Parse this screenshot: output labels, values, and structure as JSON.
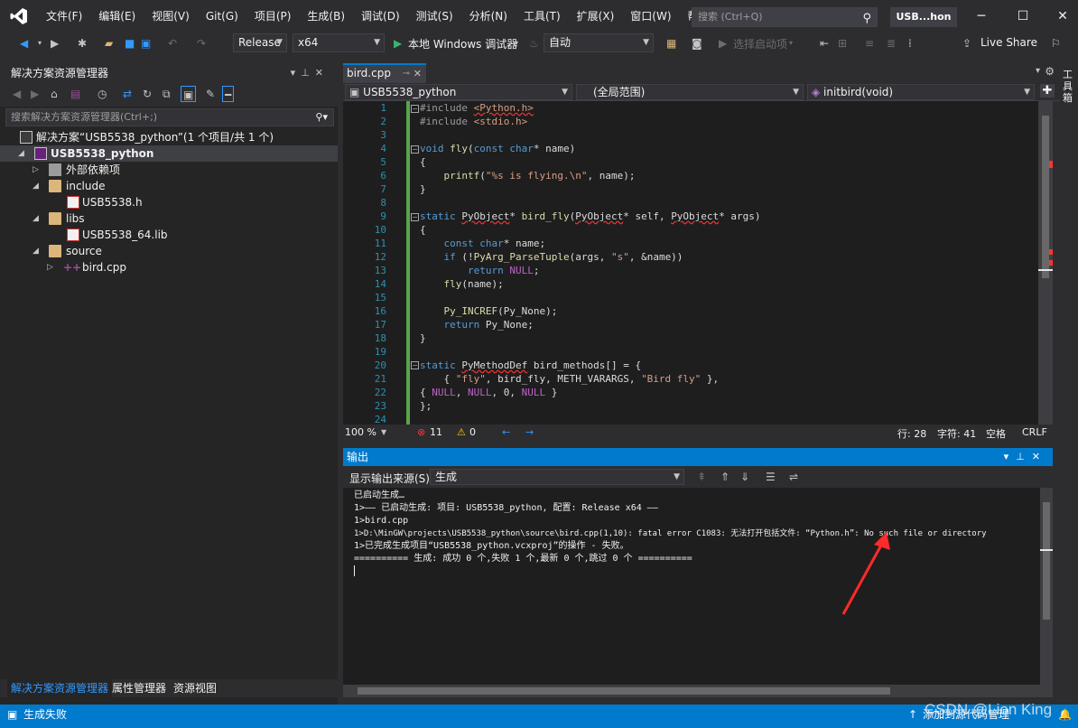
{
  "menu": {
    "items": [
      "文件(F)",
      "编辑(E)",
      "视图(V)",
      "Git(G)",
      "项目(P)",
      "生成(B)",
      "调试(D)",
      "测试(S)",
      "分析(N)",
      "工具(T)",
      "扩展(X)",
      "窗口(W)",
      "帮助(H)"
    ],
    "search_placeholder": "搜索 (Ctrl+Q)",
    "solution_name": "USB...hon"
  },
  "toolbar": {
    "config": "Release",
    "platform": "x64",
    "debugger": "本地 Windows 调试器",
    "auto": "自动",
    "startup": "选择启动项",
    "live_share": "Live Share"
  },
  "solution_explorer": {
    "title": "解决方案资源管理器",
    "search_placeholder": "搜索解决方案资源管理器(Ctrl+;)",
    "tree": [
      {
        "label": "解决方案“USB5538_python”(1 个项目/共 1 个)",
        "kind": "solution"
      },
      {
        "label": "USB5538_python",
        "kind": "project"
      },
      {
        "label": "外部依赖项",
        "kind": "references"
      },
      {
        "label": "include",
        "kind": "folder"
      },
      {
        "label": "USB5538.h",
        "kind": "header"
      },
      {
        "label": "libs",
        "kind": "folder"
      },
      {
        "label": "USB5538_64.lib",
        "kind": "lib"
      },
      {
        "label": "source",
        "kind": "folder"
      },
      {
        "label": "bird.cpp",
        "kind": "cpp"
      }
    ],
    "bottom_tabs": [
      "解决方案资源管理器",
      "属性管理器",
      "资源视图"
    ]
  },
  "editor": {
    "tab_name": "bird.cpp",
    "nav_project": "USB5538_python",
    "nav_scope": "(全局范围)",
    "nav_member": "initbird(void)",
    "line_numbers": [
      "1",
      "2",
      "3",
      "4",
      "5",
      "6",
      "7",
      "8",
      "9",
      "10",
      "11",
      "12",
      "13",
      "14",
      "15",
      "16",
      "17",
      "18",
      "19",
      "20",
      "21",
      "22",
      "23",
      "24"
    ],
    "zoom": "100 %",
    "errors": "11",
    "warnings": "0",
    "row": "行: 28",
    "col": "字符: 41",
    "whitespace": "空格",
    "eol": "CRLF"
  },
  "output": {
    "title": "输出",
    "source_label": "显示输出来源(S):",
    "source_value": "生成",
    "lines": [
      "已启动生成…",
      "1>—— 已启动生成: 项目: USB5538_python, 配置: Release x64 ——",
      "1>bird.cpp",
      "1>D:\\MinGW\\projects\\USB5538_python\\source\\bird.cpp(1,10): fatal error C1083: 无法打开包括文件: “Python.h”: No such file or directory",
      "1>已完成生成项目“USB5538_python.vcxproj”的操作 - 失败。",
      "========== 生成: 成功 0 个,失败 1 个,最新 0 个,跳过 0 个 =========="
    ]
  },
  "status": {
    "message": "生成失败",
    "right": "添加到源代码管理"
  },
  "watermark": "CSDN @Lion King",
  "side_rail": "工具箱"
}
